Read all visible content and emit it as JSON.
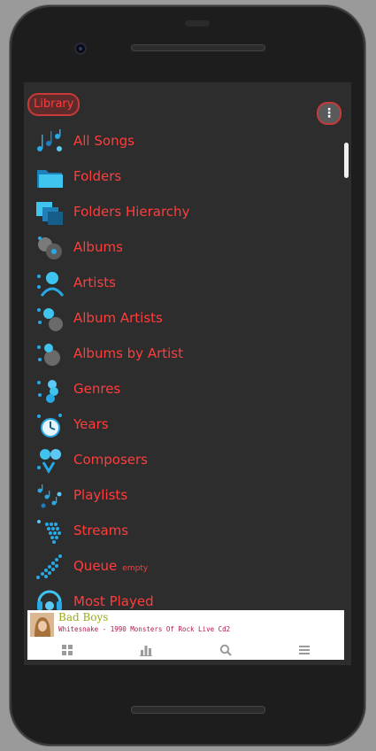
{
  "header": {
    "title": "Library",
    "menu_icon": "⋮"
  },
  "library_items": [
    {
      "label": "All Songs",
      "icon": "music-notes-icon",
      "badge": ""
    },
    {
      "label": "Folders",
      "icon": "folder-icon",
      "badge": ""
    },
    {
      "label": "Folders Hierarchy",
      "icon": "folder-hierarchy-icon",
      "badge": ""
    },
    {
      "label": "Albums",
      "icon": "album-icon",
      "badge": ""
    },
    {
      "label": "Artists",
      "icon": "artist-icon",
      "badge": ""
    },
    {
      "label": "Album Artists",
      "icon": "album-artist-icon",
      "badge": ""
    },
    {
      "label": "Albums by Artist",
      "icon": "albums-by-artist-icon",
      "badge": ""
    },
    {
      "label": "Genres",
      "icon": "genre-icon",
      "badge": ""
    },
    {
      "label": "Years",
      "icon": "years-clock-icon",
      "badge": ""
    },
    {
      "label": "Composers",
      "icon": "composer-icon",
      "badge": ""
    },
    {
      "label": "Playlists",
      "icon": "playlist-icon",
      "badge": ""
    },
    {
      "label": "Streams",
      "icon": "stream-icon",
      "badge": ""
    },
    {
      "label": "Queue",
      "icon": "queue-icon",
      "badge": "empty"
    },
    {
      "label": "Most Played",
      "icon": "most-played-icon",
      "badge": ""
    }
  ],
  "now_playing": {
    "title": "Bad Boys",
    "subtitle": "Whitesnake - 1990 Monsters Of Rock Live Cd2"
  },
  "bottom_nav": [
    {
      "icon": "grid-icon"
    },
    {
      "icon": "bar-chart-icon"
    },
    {
      "icon": "search-icon"
    },
    {
      "icon": "menu-icon"
    }
  ],
  "colors": {
    "accent": "#ff3d3d",
    "icon_blue": "#27a9e6",
    "background": "#2d2d2d"
  }
}
